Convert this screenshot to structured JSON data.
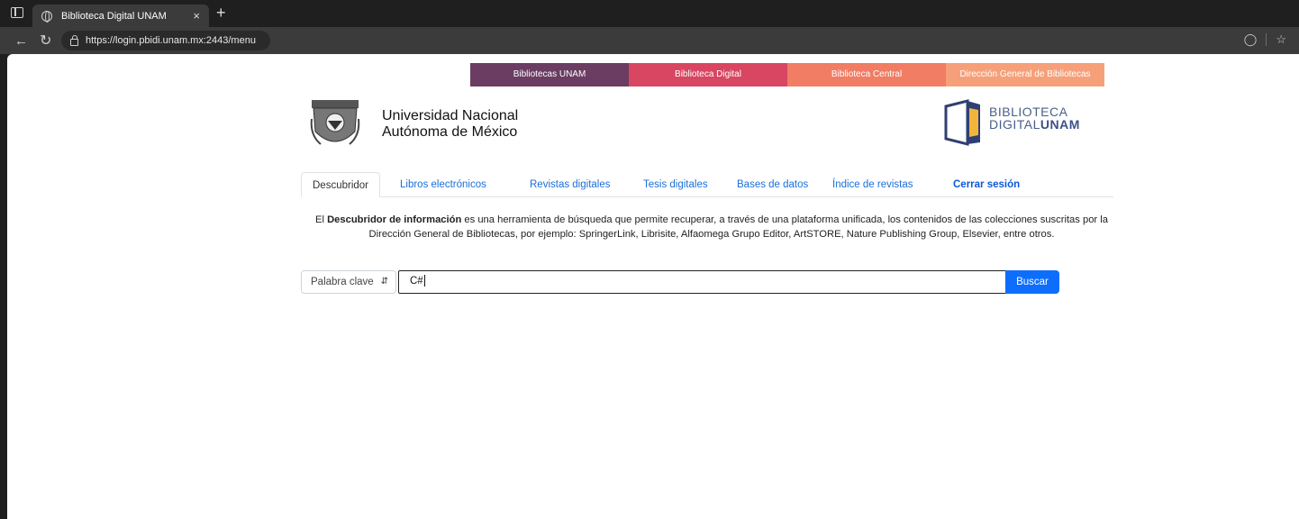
{
  "browser": {
    "tab_title": "Biblioteca Digital UNAM",
    "tab_close": "×",
    "new_tab": "+",
    "url": "https://login.pbidi.unam.mx:2443/menu"
  },
  "top_links": [
    {
      "label": "Bibliotecas UNAM",
      "color": "#6b3d63"
    },
    {
      "label": "Biblioteca Digital",
      "color": "#d84662"
    },
    {
      "label": "Biblioteca Central",
      "color": "#f07d64"
    },
    {
      "label": "Dirección General de Bibliotecas",
      "color": "#f6a07a"
    }
  ],
  "header": {
    "unam_line1": "Universidad Nacional",
    "unam_line2": "Autónoma de México",
    "bd_line1": "BIBLIOTECA",
    "bd_line2_a": "DIGITAL",
    "bd_line2_b": "UNAM"
  },
  "nav": {
    "tabs": [
      {
        "label": "Descubridor"
      },
      {
        "label": "Libros electrónicos"
      },
      {
        "label": "Revistas digitales"
      },
      {
        "label": "Tesis digitales"
      },
      {
        "label": "Bases de datos"
      },
      {
        "label": "Índice de revistas"
      },
      {
        "label": "Cerrar sesión"
      }
    ]
  },
  "description": {
    "prefix": "El ",
    "bold": "Descubridor de información",
    "rest": " es una herramienta de búsqueda que permite recuperar, a través de una plataforma unificada, los contenidos de las colecciones suscritas por la Dirección General de Bibliotecas, por ejemplo: SpringerLink, Librisite, Alfaomega Grupo Editor, ArtSTORE, Nature Publishing Group, Elsevier, entre otros."
  },
  "search": {
    "field_type": "Palabra clave",
    "query": "C#",
    "button": "Buscar"
  },
  "colors": {
    "accent": "#0d6efd",
    "link": "#1a6fd8"
  }
}
